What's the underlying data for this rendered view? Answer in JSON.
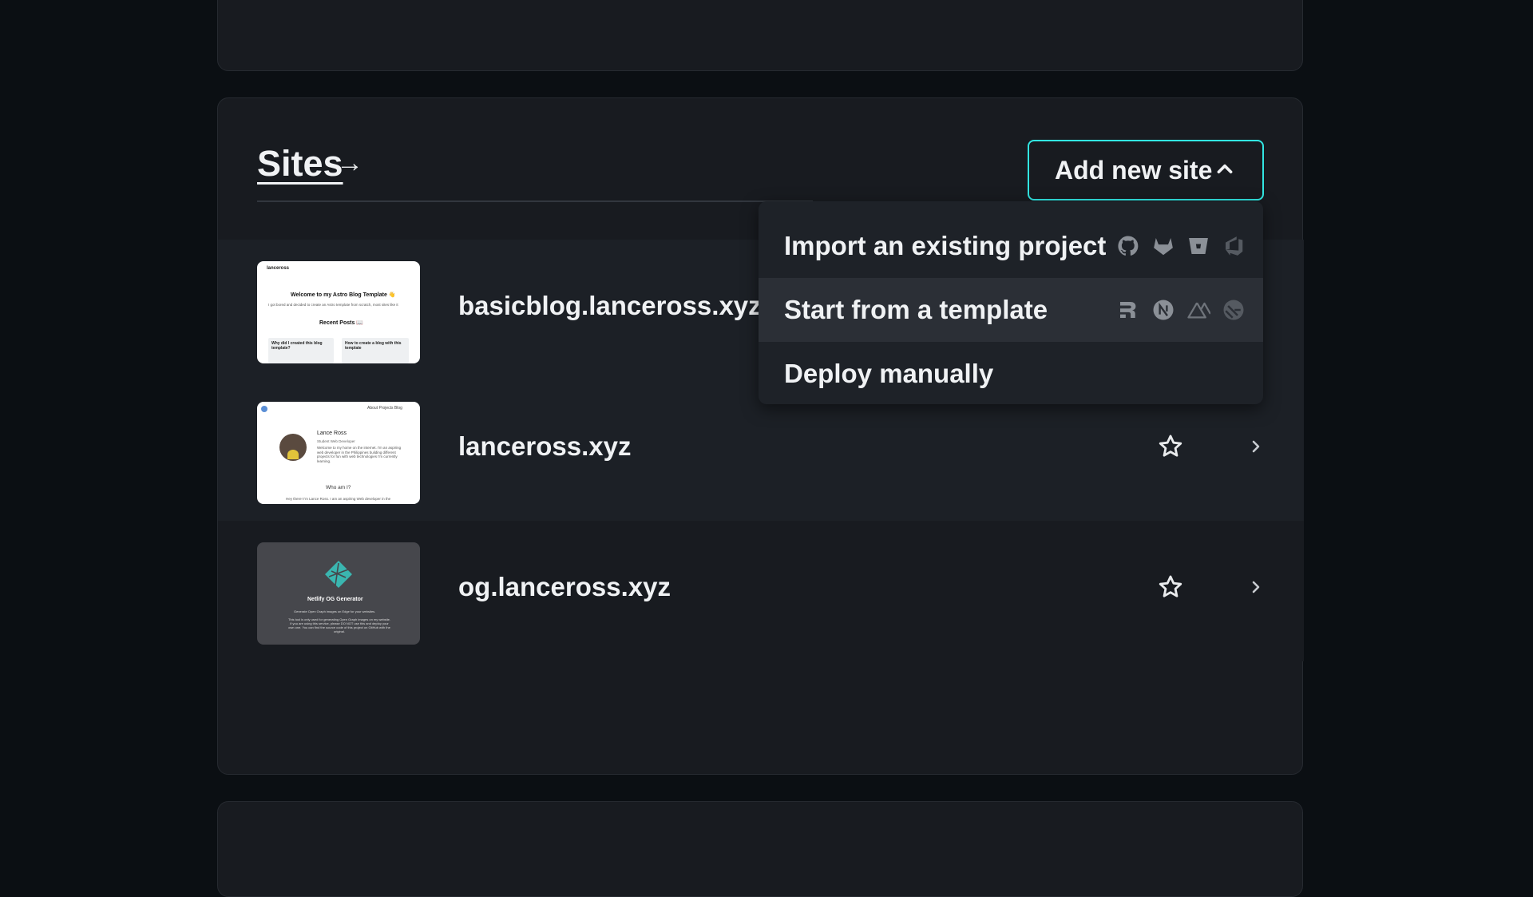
{
  "sites_section": {
    "title": "Sites",
    "arrow": "→",
    "add_button_label": "Add new site"
  },
  "menu": {
    "items": [
      {
        "label": "Import an existing project",
        "icons": [
          "github-icon",
          "gitlab-icon",
          "bitbucket-icon",
          "azure-devops-icon"
        ]
      },
      {
        "label": "Start from a template",
        "icons": [
          "remix-icon",
          "nextjs-icon",
          "nuxt-icon",
          "gatsby-icon"
        ]
      },
      {
        "label": "Deploy manually",
        "icons": []
      }
    ]
  },
  "sites": [
    {
      "name": "basicblog.lanceross.xyz",
      "thumb": {
        "brand": "lanceross",
        "heading": "Welcome to my Astro Blog Template 👋",
        "intro": "I got bored and decided to create an Astro template from scratch, most sites like it",
        "section": "Recent Posts 📖",
        "post1": "Why did I created this blog template?",
        "post2": "How to create a blog with this template"
      }
    },
    {
      "name": "lanceross.xyz",
      "thumb": {
        "nav": "About  Projects  Blog",
        "person": "Lance Ross",
        "role": "Student Web Developer",
        "bio": "Welcome to my home on the internet. I'm an aspiring web developer in the Philippines building different projects for fun with web technologies I'm currently learning.",
        "heading": "Who am I?",
        "footer": "Hey there! I'm Lance Ross. I am an aspiring Web developer in the"
      }
    },
    {
      "name": "og.lanceross.xyz",
      "thumb": {
        "heading": "Netlify OG Generator",
        "sub": "Generate Open Graph images on Edge for your websites.",
        "body": "This tool is only used for generating Open Graph images on my website. If you are using this service, please DO NOT use this and deploy your own one. You can find the source code of this project on GitHub with the original."
      }
    }
  ],
  "colors": {
    "accent": "#32e6e2",
    "background": "#0b0f13",
    "card": "#181b20"
  }
}
